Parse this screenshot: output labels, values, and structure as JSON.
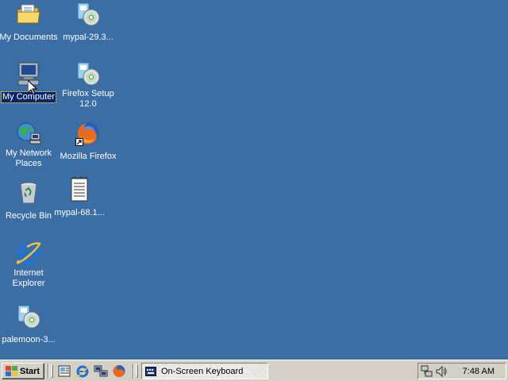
{
  "desktop": {
    "background": "#3a6ea5",
    "icons": [
      {
        "label": "My Documents",
        "icon": "folder-documents-icon"
      },
      {
        "label": "mypal-29.3...",
        "icon": "installer-disc-icon"
      },
      {
        "label": "My Computer",
        "icon": "computer-icon",
        "selected": true
      },
      {
        "label": "Firefox Setup 12.0",
        "icon": "installer-disc-icon"
      },
      {
        "label": "My Network Places",
        "icon": "network-places-icon"
      },
      {
        "label": "Mozilla Firefox",
        "icon": "firefox-icon"
      },
      {
        "label": "Recycle Bin",
        "icon": "recycle-bin-icon"
      },
      {
        "label": "mypal-68.1...",
        "icon": "text-document-icon"
      },
      {
        "label": "Internet Explorer",
        "icon": "internet-explorer-icon"
      },
      {
        "label": "palemoon-3...",
        "icon": "installer-disc-icon"
      }
    ]
  },
  "taskbar": {
    "start_label": "Start",
    "quick_launch": [
      {
        "icon": "show-desktop-icon"
      },
      {
        "icon": "internet-explorer-icon"
      },
      {
        "icon": "network-icon"
      },
      {
        "icon": "firefox-icon"
      }
    ],
    "tasks": [
      {
        "label": "On-Screen Keyboard",
        "icon": "keyboard-icon",
        "active": true
      }
    ],
    "tray": {
      "icons": [
        "network-tray-icon",
        "volume-icon"
      ],
      "clock": "7:48 AM"
    }
  }
}
